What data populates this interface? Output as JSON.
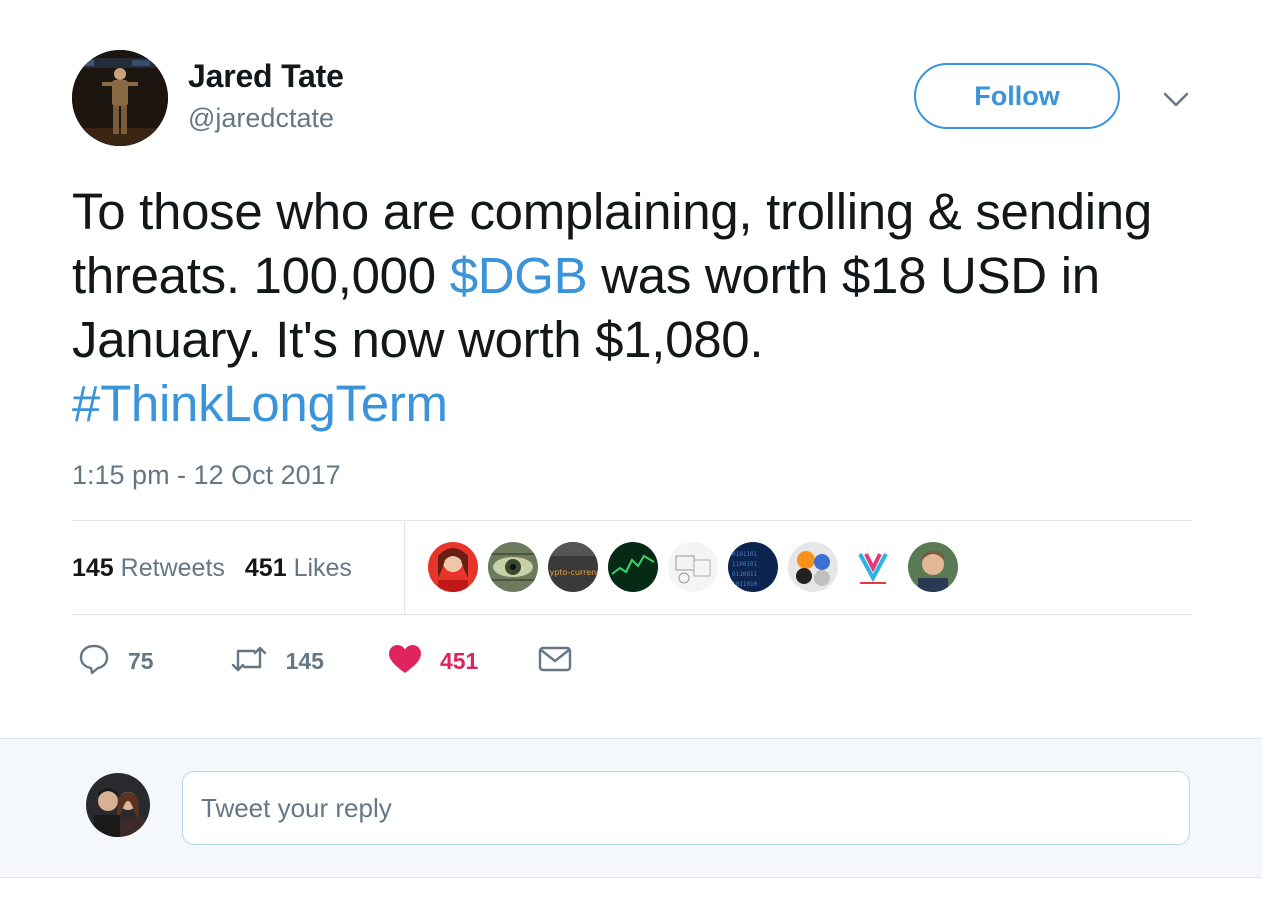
{
  "author": {
    "name": "Jared Tate",
    "handle": "@jaredctate"
  },
  "header": {
    "follow_label": "Follow",
    "menu_icon": "chevron-down-icon"
  },
  "tweet": {
    "text_part1": "To those who are complaining, trolling & sending threats. 100,000 ",
    "cashtag": "$DGB",
    "text_part2": " was worth $18 USD in January. It's now worth $1,080.",
    "hashtag": "#ThinkLongTerm",
    "timestamp": "1:15 pm - 12 Oct 2017"
  },
  "stats": {
    "retweets_count": "145",
    "retweets_label": "Retweets",
    "likes_count": "451",
    "likes_label": "Likes"
  },
  "likers": [
    {
      "name": "liker-1"
    },
    {
      "name": "liker-2"
    },
    {
      "name": "liker-3"
    },
    {
      "name": "liker-4"
    },
    {
      "name": "liker-5"
    },
    {
      "name": "liker-6"
    },
    {
      "name": "liker-7"
    },
    {
      "name": "liker-8"
    },
    {
      "name": "liker-9"
    }
  ],
  "liker_3_text": "Crypto-currency",
  "actions": {
    "replies": "75",
    "retweets": "145",
    "likes": "451"
  },
  "reply": {
    "placeholder": "Tweet your reply"
  },
  "colors": {
    "link": "#3b94d9",
    "like": "#e0245e",
    "muted": "#657786",
    "text": "#14171a",
    "border": "#e1e8ed"
  }
}
